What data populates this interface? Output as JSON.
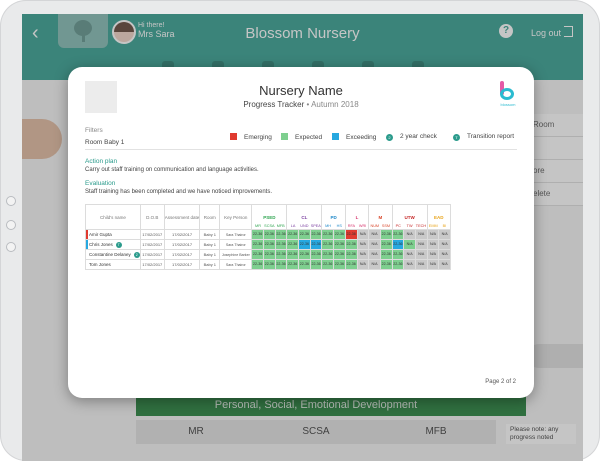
{
  "app": {
    "title": "Blossom Nursery",
    "greeting": "Hi there!",
    "user": "Mrs Sara",
    "logout_label": "Log out",
    "help_label": "?",
    "back_icon": "chevron-left-icon"
  },
  "background": {
    "right_items": [
      "Room",
      "",
      "ore",
      "elete"
    ],
    "section_band": "Personal, Social, Emotional Development",
    "columns": [
      "MR",
      "SCSA",
      "MFB"
    ],
    "note": "Please note: any progress noted"
  },
  "modal": {
    "title": "Nursery Name",
    "subtitle": "Progress Tracker",
    "term": "Autumn 2018",
    "logo_text": "blossom",
    "filters_label": "Filters",
    "room": "Room Baby 1",
    "legend": [
      {
        "label": "Emerging",
        "color": "#e03a2f",
        "shape": "square"
      },
      {
        "label": "Expected",
        "color": "#7ecf8f",
        "shape": "square"
      },
      {
        "label": "Exceeding",
        "color": "#27a8e0",
        "shape": "square"
      },
      {
        "label": "2 year check",
        "color": "#2b9b8c",
        "shape": "circle",
        "glyph": "2"
      },
      {
        "label": "Transition report",
        "color": "#2b9b8c",
        "shape": "circle",
        "glyph": "T"
      }
    ],
    "action_plan_title": "Action plan",
    "action_plan_text": "Carry out staff training on communication and language activities.",
    "evaluation_title": "Evaluation",
    "evaluation_text": "Staff training has been completed and we have noticed improvements.",
    "table": {
      "headers": [
        "Child's name",
        "D.O.B",
        "Assessment date",
        "Room",
        "Key Person"
      ],
      "areas": [
        {
          "name": "PSED",
          "color": "#2ea44f",
          "subs": [
            "MR",
            "SCSA",
            "MFB"
          ]
        },
        {
          "name": "CL",
          "color": "#7b3fa0",
          "subs": [
            "LA",
            "UND",
            "SPEA"
          ]
        },
        {
          "name": "PD",
          "color": "#1e88c9",
          "subs": [
            "MH",
            "HS"
          ]
        },
        {
          "name": "L",
          "color": "#d6336c",
          "subs": [
            "RFA",
            "WRI"
          ]
        },
        {
          "name": "M",
          "color": "#d9472b",
          "subs": [
            "NUM",
            "SSM"
          ]
        },
        {
          "name": "UTW",
          "color": "#c62828",
          "subs": [
            "PC",
            "TW",
            "TECH"
          ]
        },
        {
          "name": "EAD",
          "color": "#e8a317",
          "subs": [
            "EMM",
            "BI"
          ]
        }
      ],
      "rows": [
        {
          "name": "Amir Gupta",
          "marker": "#e03a2f",
          "badge": "",
          "dob": "17/02/2017",
          "date": "17/02/2017",
          "room": "Baby 1",
          "key": "Sara Thairor",
          "cells": [
            "22-36",
            "22-36",
            "22-36",
            "22-36",
            "22-36",
            "22-36",
            "22-36",
            "22-36",
            "22-36",
            "N/A",
            "N/A",
            "22-36",
            "22-36",
            "N/A",
            "N/A",
            "N/A",
            "N/A"
          ],
          "status": [
            "g",
            "g",
            "g",
            "g",
            "g",
            "g",
            "g",
            "g",
            "r",
            "n",
            "n",
            "g",
            "g",
            "n",
            "n",
            "n",
            "n"
          ]
        },
        {
          "name": "Chris Jones",
          "marker": "#27a8e0",
          "badge": "T",
          "dob": "17/02/2017",
          "date": "17/02/2017",
          "room": "Baby 1",
          "key": "Sara Thairor",
          "cells": [
            "22-36",
            "22-36",
            "22-36",
            "22-36",
            "22-36",
            "22-36",
            "22-36",
            "22-36",
            "22-36",
            "N/A",
            "N/A",
            "22-36",
            "22-36",
            "N/A",
            "N/A",
            "N/A",
            "N/A"
          ],
          "status": [
            "g",
            "g",
            "g",
            "g",
            "b",
            "b",
            "g",
            "g",
            "g",
            "n",
            "n",
            "g",
            "b",
            "g",
            "n",
            "n",
            "n"
          ]
        },
        {
          "name": "Constantine Delaney",
          "marker": "",
          "badge": "2",
          "dob": "17/02/2017",
          "date": "17/02/2017",
          "room": "Baby 1",
          "key": "Josephine Barker",
          "cells": [
            "22-36",
            "22-36",
            "22-36",
            "22-36",
            "22-36",
            "22-36",
            "22-36",
            "22-36",
            "22-36",
            "N/A",
            "N/A",
            "22-36",
            "22-36",
            "N/A",
            "N/A",
            "N/A",
            "N/A"
          ],
          "status": [
            "g",
            "g",
            "g",
            "g",
            "g",
            "g",
            "g",
            "g",
            "g",
            "n",
            "n",
            "g",
            "g",
            "n",
            "n",
            "n",
            "n"
          ]
        },
        {
          "name": "Tom Jones",
          "marker": "",
          "badge": "",
          "dob": "17/02/2017",
          "date": "17/02/2017",
          "room": "Baby 1",
          "key": "Sara Thairor",
          "cells": [
            "22-36",
            "22-36",
            "22-36",
            "22-36",
            "22-36",
            "22-36",
            "22-36",
            "22-36",
            "22-36",
            "N/A",
            "N/A",
            "22-36",
            "22-36",
            "N/A",
            "N/A",
            "N/A",
            "N/A"
          ],
          "status": [
            "g",
            "g",
            "g",
            "g",
            "g",
            "g",
            "g",
            "g",
            "g",
            "n",
            "n",
            "g",
            "g",
            "n",
            "n",
            "n",
            "n"
          ]
        }
      ]
    },
    "page_label": "Page 2 of 2"
  }
}
